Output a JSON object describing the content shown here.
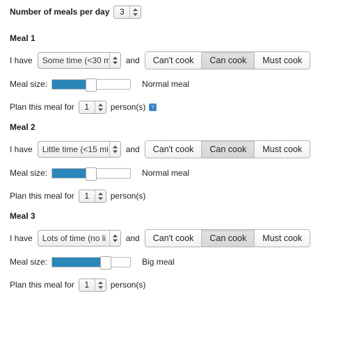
{
  "header": {
    "label": "Number of meals per day",
    "meals_per_day": "3"
  },
  "labels": {
    "i_have": "I have",
    "and": "and",
    "meal_size": "Meal size:",
    "plan_prefix": "Plan this meal for",
    "plan_suffix": "person(s)",
    "help_icon_name": "help-icon"
  },
  "cook_options": {
    "cant_cook": "Can't cook",
    "can_cook": "Can cook",
    "must_cook": "Must cook"
  },
  "colors": {
    "slider_fill": "#2b87b8",
    "help_icon": "#2e7fc2",
    "text": "#222222",
    "background": "#ffffff"
  },
  "meals": [
    {
      "title": "Meal 1",
      "time_value": "Some time (<30 m",
      "cook_selected": "Can cook",
      "size_percent": 49,
      "size_caption": "Normal meal",
      "persons": "1",
      "has_help_icon": true
    },
    {
      "title": "Meal 2",
      "time_value": "Little time (<15 mi",
      "cook_selected": "Can cook",
      "size_percent": 49,
      "size_caption": "Normal meal",
      "persons": "1",
      "has_help_icon": false
    },
    {
      "title": "Meal 3",
      "time_value": "Lots of time (no li",
      "cook_selected": "Can cook",
      "size_percent": 70,
      "size_caption": "Big meal",
      "persons": "1",
      "has_help_icon": false
    }
  ]
}
